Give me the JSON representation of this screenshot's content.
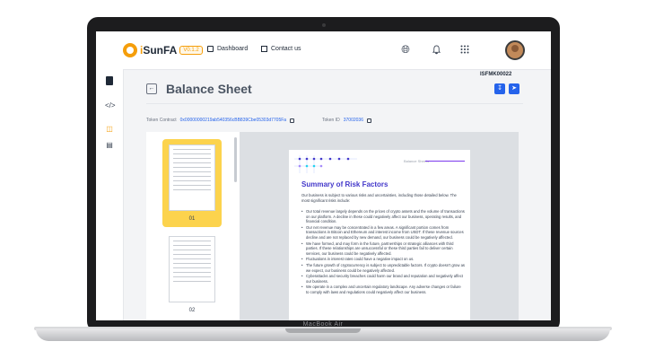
{
  "device": {
    "model_label": "MacBook Air"
  },
  "header": {
    "logo_prefix": "i",
    "logo_name": "SunFA",
    "version_badge": "V0.1.2",
    "nav": [
      {
        "label": "Dashboard",
        "icon": "layout-icon"
      },
      {
        "label": "Contact us",
        "icon": "mail-icon"
      }
    ],
    "icons": [
      "globe-icon",
      "bell-icon",
      "grid-icon",
      "avatar"
    ]
  },
  "sidebar": {
    "icons": [
      "document-icon",
      "code-icon",
      "folder-icon",
      "clipboard-icon"
    ]
  },
  "main": {
    "doc_id": "ISFMK00022",
    "title": "Balance Sheet",
    "actions": [
      "download-icon",
      "share-icon"
    ],
    "token_contract_label": "Token Contract",
    "token_contract_value": "0x00000000219ab540356cBB839Cbe05303d7705Fa",
    "token_id_label": "Token ID",
    "token_id_value": "37002036"
  },
  "thumbnails": [
    {
      "number": "01",
      "selected": true
    },
    {
      "number": "02",
      "selected": false
    }
  ],
  "document": {
    "header_label": "Balance Sheets",
    "title": "Summary of Risk Factors",
    "intro": "Our business is subject to various risks and uncertainties, including those detailed below. The most significant risks include:",
    "bullets": [
      "Our total revenue largely depends on the prices of crypto assets and the volume of transactions on our platform. A decline in these could negatively affect our business, operating results, and financial condition.",
      "Our net revenue may be concentrated in a few areas. A significant portion comes from transactions in Bitcoin and Ethereum and interest income from USDT. If these revenue sources decline and are not replaced by new demand, our business could be negatively affected.",
      "We have formed, and may form in the future, partnerships or strategic alliances with third parties. If these relationships are unsuccessful or these third parties fail to deliver certain services, our business could be negatively affected.",
      "Fluctuations in interest rates could have a negative impact on us.",
      "The future growth of cryptocurrency is subject to unpredictable factors. If crypto doesn't grow as we expect, our business could be negatively affected.",
      "Cyberattacks and security breaches could harm our brand and reputation and negatively affect our business.",
      "We operate in a complex and uncertain regulatory landscape. Any adverse changes or failure to comply with laws and regulations could negatively affect our business."
    ]
  },
  "colors": {
    "accent": "#f59e0b",
    "primary": "#2563eb",
    "doc_title": "#4338ca"
  }
}
